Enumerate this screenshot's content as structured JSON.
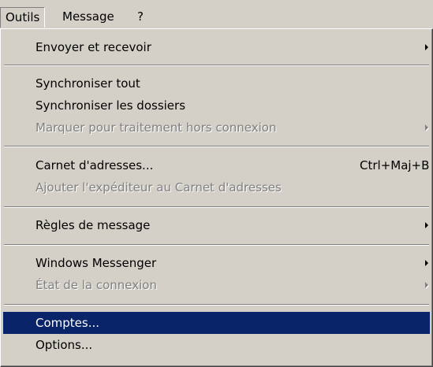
{
  "menubar": {
    "items": [
      {
        "label": "Outils"
      },
      {
        "label": "Message"
      },
      {
        "label": "?"
      }
    ]
  },
  "menu": {
    "items": [
      {
        "label": "Envoyer et recevoir",
        "submenu": true,
        "disabled": false
      },
      {
        "label": "Synchroniser tout",
        "disabled": false
      },
      {
        "label": "Synchroniser les dossiers",
        "disabled": false
      },
      {
        "label": "Marquer pour traitement hors connexion",
        "submenu": true,
        "disabled": true
      },
      {
        "label": "Carnet d'adresses...",
        "shortcut": "Ctrl+Maj+B",
        "disabled": false
      },
      {
        "label": "Ajouter l'expéditeur au Carnet d'adresses",
        "disabled": true
      },
      {
        "label": "Règles de message",
        "submenu": true,
        "disabled": false
      },
      {
        "label": "Windows Messenger",
        "submenu": true,
        "disabled": false
      },
      {
        "label": "État de la connexion",
        "submenu": true,
        "disabled": true
      },
      {
        "label": "Comptes...",
        "disabled": false,
        "highlighted": true
      },
      {
        "label": "Options...",
        "disabled": false
      }
    ]
  },
  "colors": {
    "face": "#d4d0c8",
    "highlight": "#0a246a",
    "disabled_text": "#808080"
  }
}
